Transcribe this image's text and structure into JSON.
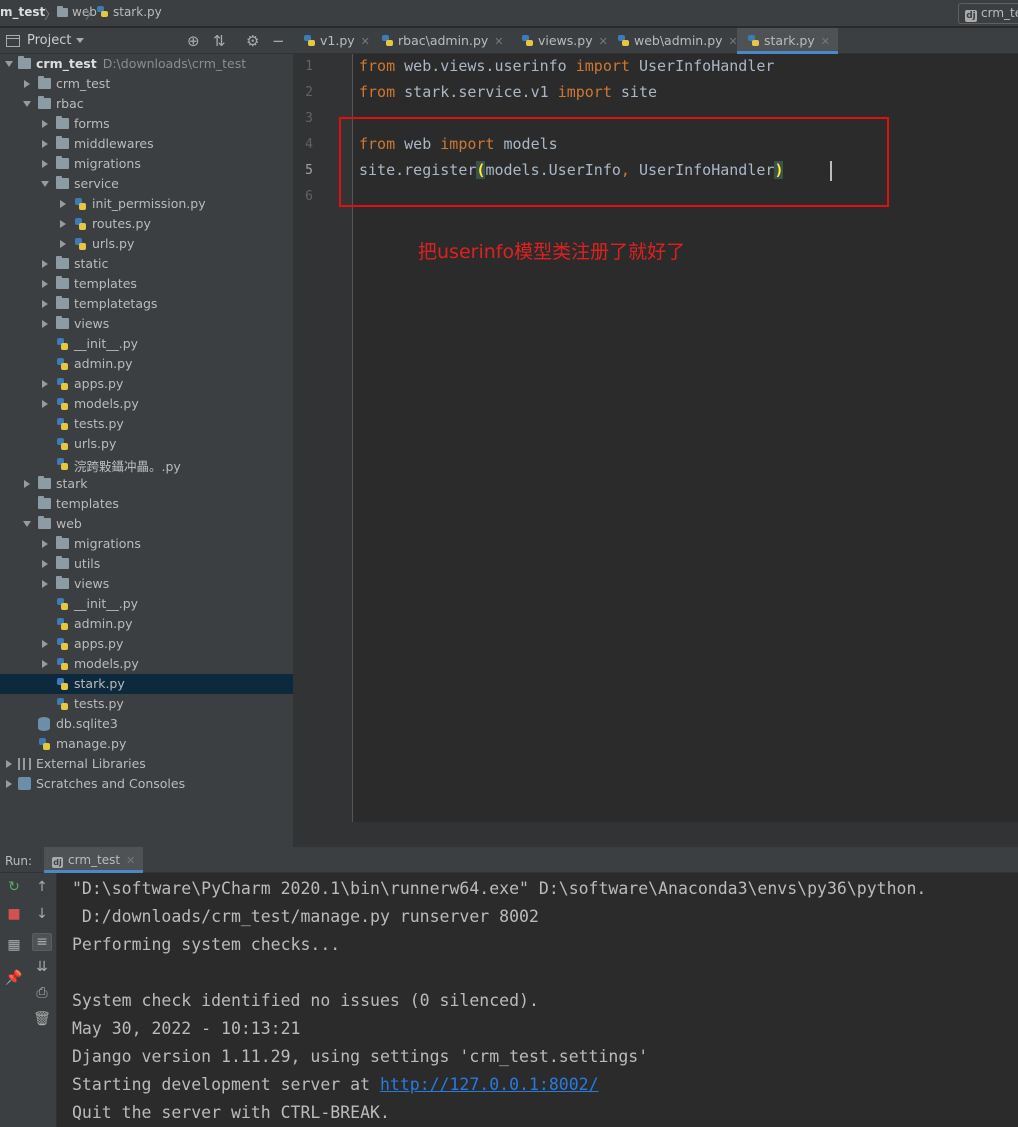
{
  "titlebar": {
    "crumb1": "m_test",
    "crumb2": "web",
    "crumb3": "stark.py",
    "run_config": "crm_test"
  },
  "project_panel": {
    "title": "Project",
    "tree": [
      {
        "label": "crm_test",
        "path": "D:\\downloads\\crm_test"
      },
      {
        "label": "crm_test"
      },
      {
        "label": "rbac"
      },
      {
        "label": "forms"
      },
      {
        "label": "middlewares"
      },
      {
        "label": "migrations"
      },
      {
        "label": "service"
      },
      {
        "label": "init_permission.py"
      },
      {
        "label": "routes.py"
      },
      {
        "label": "urls.py"
      },
      {
        "label": "static"
      },
      {
        "label": "templates"
      },
      {
        "label": "templatetags"
      },
      {
        "label": "views"
      },
      {
        "label": "__init__.py"
      },
      {
        "label": "admin.py"
      },
      {
        "label": "apps.py"
      },
      {
        "label": "models.py"
      },
      {
        "label": "tests.py"
      },
      {
        "label": "urls.py"
      },
      {
        "label": "浣跨敤鑷冲畾。.py"
      },
      {
        "label": "stark"
      },
      {
        "label": "templates"
      },
      {
        "label": "web"
      },
      {
        "label": "migrations"
      },
      {
        "label": "utils"
      },
      {
        "label": "views"
      },
      {
        "label": "__init__.py"
      },
      {
        "label": "admin.py"
      },
      {
        "label": "apps.py"
      },
      {
        "label": "models.py"
      },
      {
        "label": "stark.py"
      },
      {
        "label": "tests.py"
      },
      {
        "label": "db.sqlite3"
      },
      {
        "label": "manage.py"
      },
      {
        "label": "External Libraries"
      },
      {
        "label": "Scratches and Consoles"
      }
    ]
  },
  "tabs": [
    {
      "label": "v1.py"
    },
    {
      "label": "rbac\\admin.py"
    },
    {
      "label": "views.py"
    },
    {
      "label": "web\\admin.py"
    },
    {
      "label": "stark.py",
      "active": true
    }
  ],
  "editor": {
    "line_numbers": [
      "1",
      "2",
      "3",
      "4",
      "5",
      "6"
    ],
    "line1": {
      "kw1": "from",
      "t1": " web.views.userinfo ",
      "kw2": "import",
      "t2": " UserInfoHandler"
    },
    "line2": {
      "kw1": "from",
      "t1": " stark.service.v1 ",
      "kw2": "import",
      "t2": " site"
    },
    "line4": {
      "kw1": "from",
      "t1": " web ",
      "kw2": "import",
      "t2": " models"
    },
    "line5": {
      "t1": "site.register",
      "p1": "(",
      "t2": "models.UserInfo",
      "comma": ",",
      "t3": " UserInfoHandler",
      "p2": ")"
    },
    "annotation": "把userinfo模型类注册了就好了"
  },
  "run_panel": {
    "label": "Run:",
    "tab": "crm_test",
    "lines": [
      "\"D:\\software\\PyCharm 2020.1\\bin\\runnerw64.exe\" D:\\software\\Anaconda3\\envs\\py36\\python.",
      " D:/downloads/crm_test/manage.py runserver 8002",
      "Performing system checks...",
      "",
      "System check identified no issues (0 silenced).",
      "May 30, 2022 - 10:13:21",
      "Django version 1.11.29, using settings 'crm_test.settings'",
      "Starting development server at ",
      "Quit the server with CTRL-BREAK."
    ],
    "link": "http://127.0.0.1:8002/"
  },
  "colors": {
    "keyword": "#cc7832",
    "text": "#a9b7c6",
    "annotation": "#e02020",
    "link": "#287bde"
  }
}
